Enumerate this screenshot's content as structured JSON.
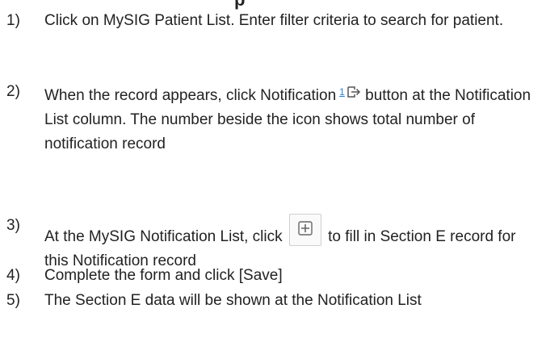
{
  "heading_fragment": "p",
  "steps": [
    {
      "number": "1)",
      "text_a": "Click on MySIG Patient List. Enter filter criteria to search for patient."
    },
    {
      "number": "2)",
      "text_a": "When the record appears, click Notification",
      "badge": "1",
      "text_b": "button at the Notification List column.  The number beside the icon shows total number of notification record"
    },
    {
      "number": "3)",
      "text_a": "At the MySIG Notification List, click",
      "text_b": "to fill in Section E record for this Notification record"
    },
    {
      "number": "4)",
      "text_a": "Complete the form and click [Save]"
    },
    {
      "number": "5)",
      "text_a": "The Section E data will be shown at the Notification List"
    }
  ],
  "icons": {
    "notification": "open-external-icon",
    "add": "plus-box-icon"
  }
}
